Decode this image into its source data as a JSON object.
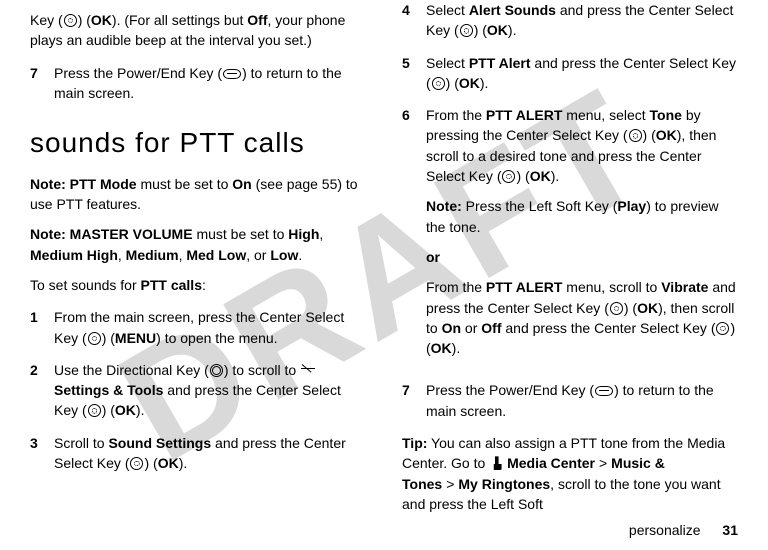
{
  "watermark": "DRAFT",
  "left": {
    "p0a": "Key (",
    "p0b": ") (",
    "ok": "OK",
    "p0c": "). (For all settings but ",
    "off": "Off",
    "p0d": ", your phone plays an audible beep at the interval you set.)",
    "s7n": "7",
    "s7a": "Press the Power/End Key (",
    "s7b": ") to return to the main screen.",
    "heading": "sounds for PTT calls",
    "note1a": "Note:",
    "pttmode": "PTT Mode",
    "note1b": " must be set to ",
    "on": "On",
    "note1c": " (see page 55) to use PTT features.",
    "note2a": "Note:",
    "mv": "MASTER VOLUME",
    "note2b": " must be set to ",
    "high": "High",
    "comma": ", ",
    "mh": "Medium High",
    "medium": "Medium",
    "ml": "Med Low",
    "or": ", or ",
    "low": "Low",
    "period": ".",
    "intro": "To set sounds for ",
    "pttcalls": "PTT calls",
    "colon": ":",
    "s1n": "1",
    "s1a": "From the main screen, press the Center Select Key (",
    "s1b": ") (",
    "menu": "MENU",
    "s1c": ") to open the menu.",
    "s2n": "2",
    "s2a": "Use the Directional Key (",
    "s2b": ") to scroll to ",
    "settingsTools": " Settings & Tools",
    "s2c": " and press the Center Select Key (",
    "s2d": ") (",
    "s2e": ").",
    "s3n": "3",
    "s3a": "Scroll to ",
    "soundSettings": "Sound Settings",
    "s3b": " and press the Center Select Key (",
    "s3c": ") (",
    "s3d": ")."
  },
  "right": {
    "s4n": "4",
    "s4a": "Select ",
    "alertSounds": "Alert Sounds",
    "s4b": " and press the Center Select Key (",
    "s4c": ") (",
    "ok": "OK",
    "s4d": ").",
    "s5n": "5",
    "s5a": "Select ",
    "pttAlert": "PTT Alert",
    "s5b": " and press the Center Select Key (",
    "s5c": ") (",
    "s5d": ").",
    "s6n": "6",
    "s6a": "From the ",
    "pttAlertMenu": "PTT ALERT",
    "s6b": " menu, select ",
    "tone": "Tone",
    "s6c": " by pressing the Center Select Key (",
    "s6d": ") (",
    "s6e": "), then scroll to a desired tone and press the Center Select Key (",
    "s6f": ") (",
    "s6g": ").",
    "note3a": "Note:",
    "note3b": " Press the Left Soft Key (",
    "play": "Play",
    "note3c": ") to preview the tone.",
    "orWord": "or",
    "altA": "From the ",
    "altB": " menu, scroll to ",
    "vibrate": "Vibrate",
    "altC": " and press the Center Select Key (",
    "altD": ") (",
    "altE": "), then scroll to ",
    "on": "On",
    "orInline": " or ",
    "off": "Off",
    "altF": " and press the Center Select Key (",
    "altG": ") (",
    "altH": ").",
    "s7n": "7",
    "s7a": "Press the Power/End Key (",
    "s7b": ") to return to the main screen.",
    "tipA": "Tip:",
    "tipB": " You can also assign a PTT tone from the Media Center. Go to ",
    "mediaCenter": "Media Center",
    "gt": ">",
    "musicTones": "Music & Tones",
    "myRingtones": "My Ringtones",
    "tipC": ", scroll to the tone you want and press the Left Soft"
  },
  "footer": {
    "section": "personalize",
    "page": "31"
  }
}
